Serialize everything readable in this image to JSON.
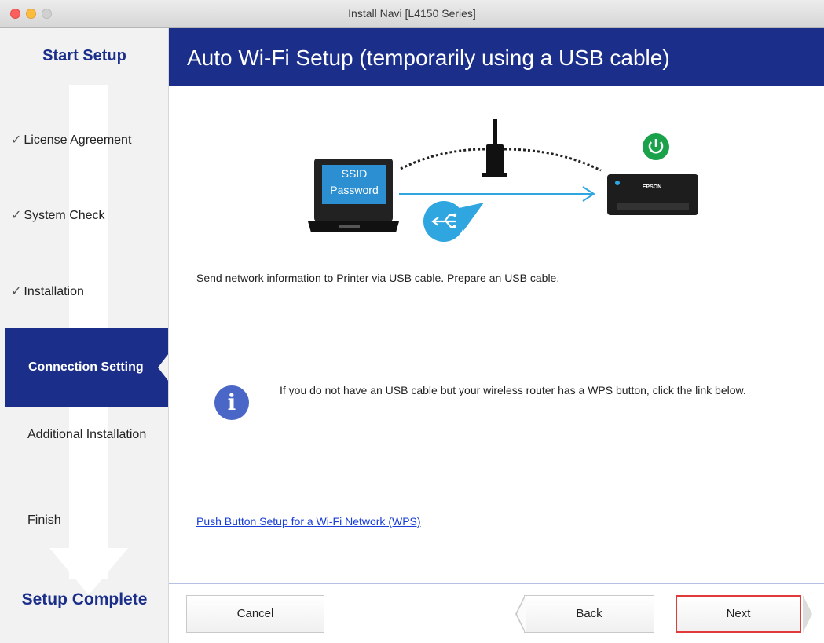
{
  "window": {
    "title": "Install Navi [L4150 Series]"
  },
  "sidebar": {
    "start_title": "Start Setup",
    "complete_title": "Setup Complete",
    "check_mark": "✓",
    "steps": [
      {
        "label": "License Agreement",
        "done": true
      },
      {
        "label": "System Check",
        "done": true
      },
      {
        "label": "Installation",
        "done": true
      },
      {
        "label": "Connection Setting",
        "active": true
      },
      {
        "label": "Additional Installation"
      },
      {
        "label": "Finish"
      }
    ]
  },
  "main": {
    "header_title": "Auto Wi-Fi Setup (temporarily using a USB cable)",
    "illustration": {
      "laptop_line1": "SSID",
      "laptop_line2": "Password",
      "printer_brand": "EPSON",
      "icons": [
        "laptop-icon",
        "router-icon",
        "usb-icon",
        "printer-icon",
        "power-icon"
      ]
    },
    "description": "Send network information to Printer via USB cable. Prepare an USB cable.",
    "info_text": "If you do not have an USB cable but your wireless router has a WPS button, click the link below.",
    "wps_link": "Push Button Setup for a Wi-Fi Network (WPS)"
  },
  "buttons": {
    "cancel": "Cancel",
    "back": "Back",
    "next": "Next"
  },
  "colors": {
    "brand_blue": "#1b2f8a",
    "info_blue": "#4a67c7",
    "link_blue": "#1a3fd6",
    "power_green": "#1aa24b",
    "cable_blue": "#2fa6e0",
    "highlight_red": "#e03a3a"
  }
}
